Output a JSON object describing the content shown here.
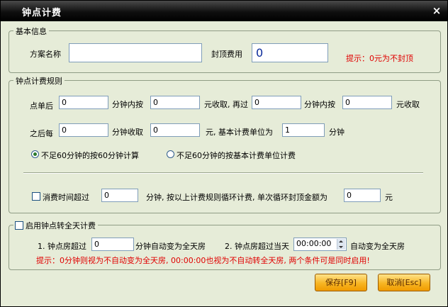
{
  "window": {
    "title": "钟点计费",
    "close_glyph": "×"
  },
  "basic": {
    "legend": "基本信息",
    "plan_name_label": "方案名称",
    "plan_name_value": "",
    "cap_label": "封顶费用",
    "cap_value": "0",
    "hint": "提示：0元为不封顶"
  },
  "rules": {
    "legend": "钟点计费规则",
    "row1": {
      "after_order_label": "点单后",
      "after_order_value": "0",
      "minutes_within_label": "分钟内按",
      "first_charge_value": "0",
      "charge_then_label": "元收取, 再过",
      "second_minutes_value": "0",
      "minutes_within2_label": "分钟内按",
      "second_charge_value": "0",
      "charge_label": "元收取"
    },
    "row2": {
      "then_every_label": "之后每",
      "every_minutes_value": "0",
      "minutes_charge_label": "分钟收取",
      "every_charge_value": "0",
      "base_unit_label": "元, 基本计费单位为",
      "base_unit_value": "1",
      "minute_label": "分钟"
    },
    "radio1_label": "不足60分钟的按60分钟计算",
    "radio2_label": "不足60分钟的按基本计费单位计费",
    "loop": {
      "label_start": "消费时间超过",
      "minutes_value": "0",
      "label_mid": "分钟, 按以上计费规则循环计费, 单次循环封顶金额为",
      "cap_value": "0",
      "label_end": "元"
    }
  },
  "fullday": {
    "legend": "启用钟点转全天计费",
    "item1_label": "1. 钟点房超过",
    "item1_value": "0",
    "item1_suffix": "分钟自动变为全天房",
    "item2_label": "2. 钟点房超过当天",
    "item2_value": "00:00:00",
    "item2_suffix": "自动变为全天房",
    "hint": "提示：0分钟则视为不自动变为全天房, 00:00:00也视为不自动转全天房, 两个条件可是同时启用!"
  },
  "buttons": {
    "save": "保存[F9]",
    "cancel": "取消[Esc]"
  },
  "colors": {
    "accent": "#f7b523",
    "hint": "#e00000",
    "titlebar": "#000000",
    "background": "#e6ecd8"
  }
}
